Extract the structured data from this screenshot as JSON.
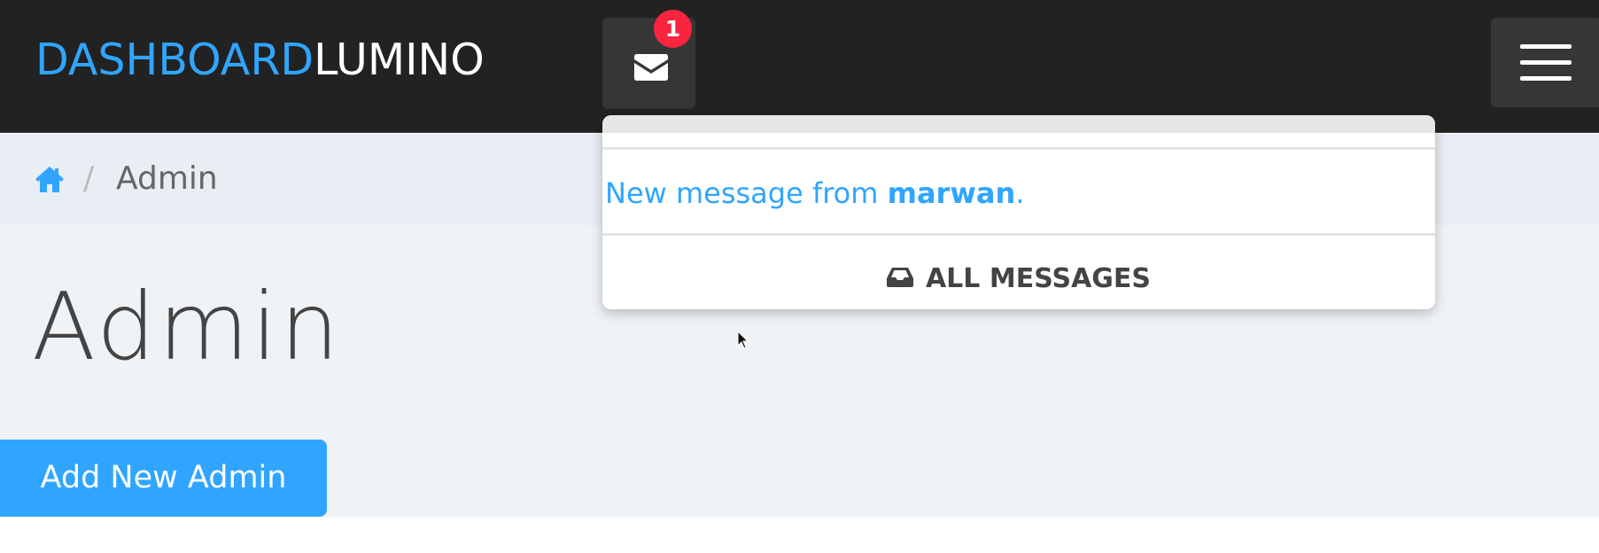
{
  "navbar": {
    "brand_part1": "DASHBOARD",
    "brand_part2": "LUMINO",
    "message_icon": "envelope-icon",
    "message_count": "1",
    "menu_icon": "hamburger-icon"
  },
  "messages_dropdown": {
    "message_prefix": "New message from ",
    "message_sender": "marwan",
    "message_suffix": ".",
    "all_messages_icon": "inbox-icon",
    "all_messages_label": "ALL MESSAGES"
  },
  "breadcrumb": {
    "home_icon": "home-icon",
    "separator": "/",
    "current": "Admin"
  },
  "main": {
    "title": "Admin",
    "add_button_label": "Add New Admin"
  },
  "colors": {
    "accent": "#30a5ff",
    "navbar_bg": "#222222",
    "badge": "#f9243f",
    "breadcrumb_bg": "#e9edf4",
    "content_bg": "#f0f3f6"
  }
}
